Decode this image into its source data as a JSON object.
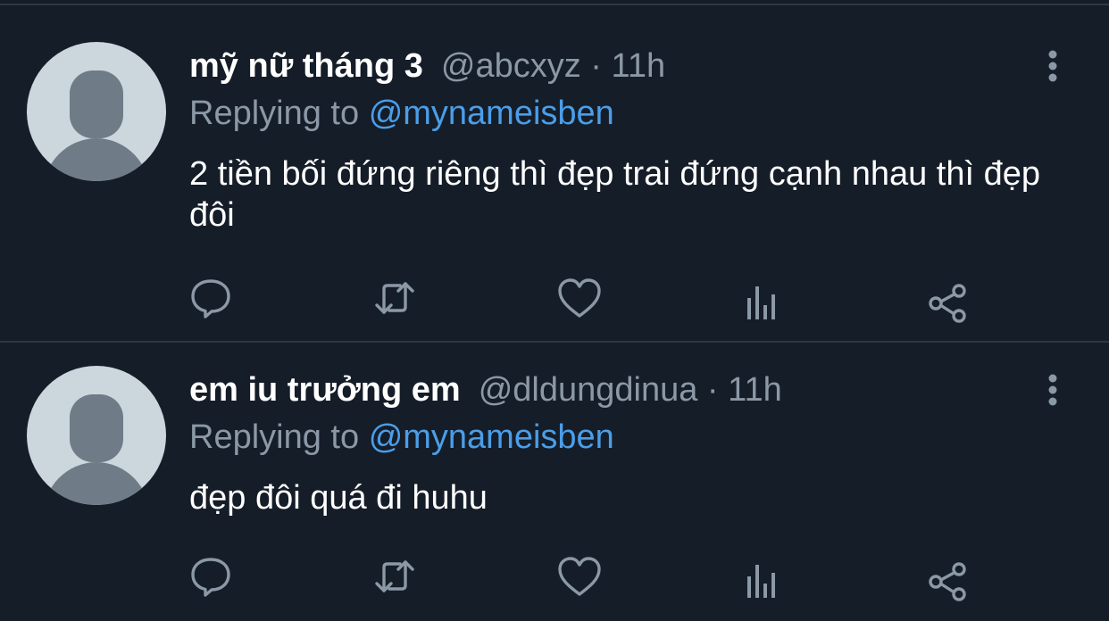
{
  "colors": {
    "background": "#151d28",
    "divider": "#2f3842",
    "primary_text": "#ffffff",
    "secondary_text": "#8b98a5",
    "mention": "#4a9ee9",
    "avatar_bg": "#ccd6dd",
    "avatar_fg": "#6f7b86"
  },
  "tweets": [
    {
      "display_name": "mỹ nữ tháng 3",
      "handle": "@abcxyz",
      "separator": "·",
      "time": "11h",
      "replying_prefix": "Replying to",
      "replying_to": "@mynameisben",
      "text": "2 tiền bối đứng riêng thì đẹp trai đứng cạnh nhau thì đẹp đôi",
      "avatar_icon": "default-avatar-icon",
      "actions": [
        "reply-icon",
        "retweet-icon",
        "like-icon",
        "views-icon",
        "share-icon"
      ]
    },
    {
      "display_name": "em iu trưởng em",
      "handle": "@dldungdinua",
      "separator": "·",
      "time": "11h",
      "replying_prefix": "Replying to",
      "replying_to": "@mynameisben",
      "text": "đẹp đôi quá đi huhu",
      "avatar_icon": "default-avatar-icon",
      "actions": [
        "reply-icon",
        "retweet-icon",
        "like-icon",
        "views-icon",
        "share-icon"
      ]
    }
  ]
}
